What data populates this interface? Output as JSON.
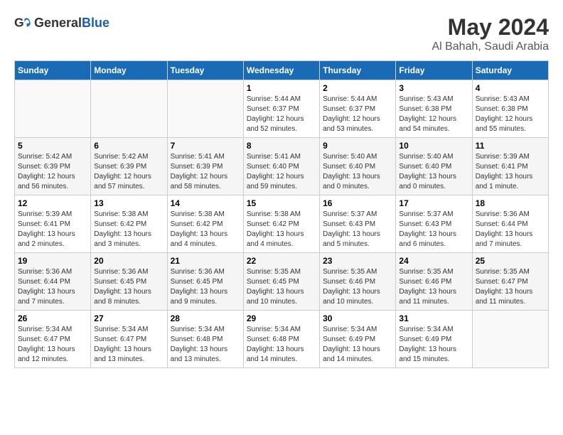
{
  "header": {
    "logo_general": "General",
    "logo_blue": "Blue",
    "title": "May 2024",
    "subtitle": "Al Bahah, Saudi Arabia"
  },
  "days_of_week": [
    "Sunday",
    "Monday",
    "Tuesday",
    "Wednesday",
    "Thursday",
    "Friday",
    "Saturday"
  ],
  "weeks": [
    [
      {
        "num": "",
        "info": ""
      },
      {
        "num": "",
        "info": ""
      },
      {
        "num": "",
        "info": ""
      },
      {
        "num": "1",
        "info": "Sunrise: 5:44 AM\nSunset: 6:37 PM\nDaylight: 12 hours\nand 52 minutes."
      },
      {
        "num": "2",
        "info": "Sunrise: 5:44 AM\nSunset: 6:37 PM\nDaylight: 12 hours\nand 53 minutes."
      },
      {
        "num": "3",
        "info": "Sunrise: 5:43 AM\nSunset: 6:38 PM\nDaylight: 12 hours\nand 54 minutes."
      },
      {
        "num": "4",
        "info": "Sunrise: 5:43 AM\nSunset: 6:38 PM\nDaylight: 12 hours\nand 55 minutes."
      }
    ],
    [
      {
        "num": "5",
        "info": "Sunrise: 5:42 AM\nSunset: 6:39 PM\nDaylight: 12 hours\nand 56 minutes."
      },
      {
        "num": "6",
        "info": "Sunrise: 5:42 AM\nSunset: 6:39 PM\nDaylight: 12 hours\nand 57 minutes."
      },
      {
        "num": "7",
        "info": "Sunrise: 5:41 AM\nSunset: 6:39 PM\nDaylight: 12 hours\nand 58 minutes."
      },
      {
        "num": "8",
        "info": "Sunrise: 5:41 AM\nSunset: 6:40 PM\nDaylight: 12 hours\nand 59 minutes."
      },
      {
        "num": "9",
        "info": "Sunrise: 5:40 AM\nSunset: 6:40 PM\nDaylight: 13 hours\nand 0 minutes."
      },
      {
        "num": "10",
        "info": "Sunrise: 5:40 AM\nSunset: 6:40 PM\nDaylight: 13 hours\nand 0 minutes."
      },
      {
        "num": "11",
        "info": "Sunrise: 5:39 AM\nSunset: 6:41 PM\nDaylight: 13 hours\nand 1 minute."
      }
    ],
    [
      {
        "num": "12",
        "info": "Sunrise: 5:39 AM\nSunset: 6:41 PM\nDaylight: 13 hours\nand 2 minutes."
      },
      {
        "num": "13",
        "info": "Sunrise: 5:38 AM\nSunset: 6:42 PM\nDaylight: 13 hours\nand 3 minutes."
      },
      {
        "num": "14",
        "info": "Sunrise: 5:38 AM\nSunset: 6:42 PM\nDaylight: 13 hours\nand 4 minutes."
      },
      {
        "num": "15",
        "info": "Sunrise: 5:38 AM\nSunset: 6:42 PM\nDaylight: 13 hours\nand 4 minutes."
      },
      {
        "num": "16",
        "info": "Sunrise: 5:37 AM\nSunset: 6:43 PM\nDaylight: 13 hours\nand 5 minutes."
      },
      {
        "num": "17",
        "info": "Sunrise: 5:37 AM\nSunset: 6:43 PM\nDaylight: 13 hours\nand 6 minutes."
      },
      {
        "num": "18",
        "info": "Sunrise: 5:36 AM\nSunset: 6:44 PM\nDaylight: 13 hours\nand 7 minutes."
      }
    ],
    [
      {
        "num": "19",
        "info": "Sunrise: 5:36 AM\nSunset: 6:44 PM\nDaylight: 13 hours\nand 7 minutes."
      },
      {
        "num": "20",
        "info": "Sunrise: 5:36 AM\nSunset: 6:45 PM\nDaylight: 13 hours\nand 8 minutes."
      },
      {
        "num": "21",
        "info": "Sunrise: 5:36 AM\nSunset: 6:45 PM\nDaylight: 13 hours\nand 9 minutes."
      },
      {
        "num": "22",
        "info": "Sunrise: 5:35 AM\nSunset: 6:45 PM\nDaylight: 13 hours\nand 10 minutes."
      },
      {
        "num": "23",
        "info": "Sunrise: 5:35 AM\nSunset: 6:46 PM\nDaylight: 13 hours\nand 10 minutes."
      },
      {
        "num": "24",
        "info": "Sunrise: 5:35 AM\nSunset: 6:46 PM\nDaylight: 13 hours\nand 11 minutes."
      },
      {
        "num": "25",
        "info": "Sunrise: 5:35 AM\nSunset: 6:47 PM\nDaylight: 13 hours\nand 11 minutes."
      }
    ],
    [
      {
        "num": "26",
        "info": "Sunrise: 5:34 AM\nSunset: 6:47 PM\nDaylight: 13 hours\nand 12 minutes."
      },
      {
        "num": "27",
        "info": "Sunrise: 5:34 AM\nSunset: 6:47 PM\nDaylight: 13 hours\nand 13 minutes."
      },
      {
        "num": "28",
        "info": "Sunrise: 5:34 AM\nSunset: 6:48 PM\nDaylight: 13 hours\nand 13 minutes."
      },
      {
        "num": "29",
        "info": "Sunrise: 5:34 AM\nSunset: 6:48 PM\nDaylight: 13 hours\nand 14 minutes."
      },
      {
        "num": "30",
        "info": "Sunrise: 5:34 AM\nSunset: 6:49 PM\nDaylight: 13 hours\nand 14 minutes."
      },
      {
        "num": "31",
        "info": "Sunrise: 5:34 AM\nSunset: 6:49 PM\nDaylight: 13 hours\nand 15 minutes."
      },
      {
        "num": "",
        "info": ""
      }
    ]
  ]
}
